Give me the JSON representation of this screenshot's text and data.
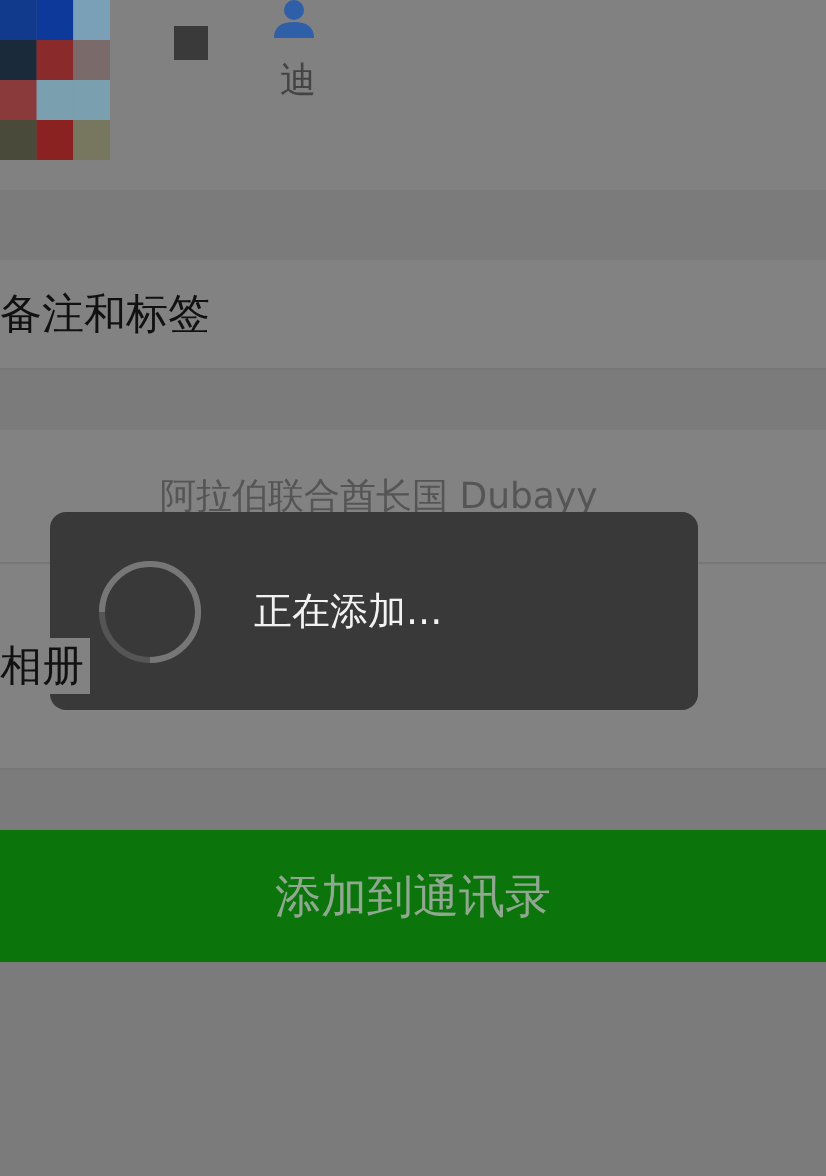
{
  "profile": {
    "name": "迪"
  },
  "rows": [
    {
      "label": "备注和标签"
    },
    {
      "label": "",
      "value": "阿拉伯联合酋长国  Dubayy"
    },
    {
      "label": "相册"
    }
  ],
  "add_button": {
    "label": "添加到通讯录"
  },
  "toast": {
    "message": "正在添加..."
  }
}
